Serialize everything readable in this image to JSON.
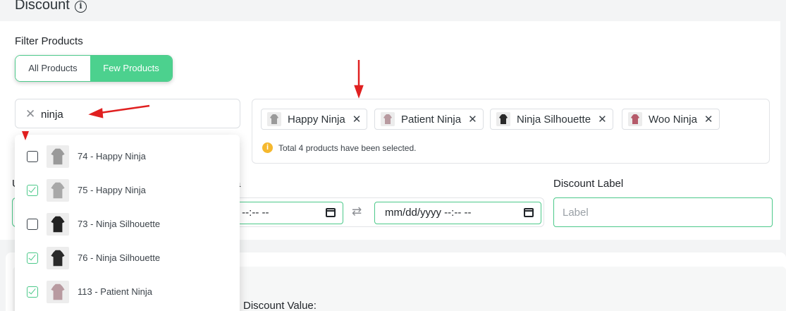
{
  "header": {
    "title": "Discount"
  },
  "filter": {
    "label": "Filter Products",
    "toggle": {
      "all": "All Products",
      "few": "Few Products",
      "selected": "Few Products"
    }
  },
  "search": {
    "value": "ninja",
    "placeholder": ""
  },
  "selected": {
    "chips": [
      {
        "label": "Happy Ninja",
        "color": "#9a9a9a"
      },
      {
        "label": "Patient Ninja",
        "color": "#b89aa0"
      },
      {
        "label": "Ninja Silhouette",
        "color": "#2a2a2a"
      },
      {
        "label": "Woo Ninja",
        "color": "#b55a6a"
      }
    ],
    "summary": "Total 4 products have been selected."
  },
  "fields": {
    "left_label_fragment": "U",
    "date_label_fragment": "a",
    "date_start_value": "yy --:-- --",
    "date_end_value": "mm/dd/yyyy --:-- --",
    "discount_label": "Discount Label",
    "label_placeholder": "Label",
    "discount_value": "Discount Value:"
  },
  "dropdown": {
    "items": [
      {
        "label": "74 - Happy Ninja",
        "checked": false,
        "color": "#9a9a9a"
      },
      {
        "label": "75 - Happy Ninja",
        "checked": true,
        "color": "#a8a8a8"
      },
      {
        "label": "73 - Ninja Silhouette",
        "checked": false,
        "color": "#222222"
      },
      {
        "label": "76 - Ninja Silhouette",
        "checked": true,
        "color": "#2a2a2a"
      },
      {
        "label": "113 - Patient Ninja",
        "checked": true,
        "color": "#b89aa0"
      }
    ]
  },
  "colors": {
    "accent": "#4cd18e",
    "annotation": "#e02020",
    "warning": "#f5b82e"
  }
}
